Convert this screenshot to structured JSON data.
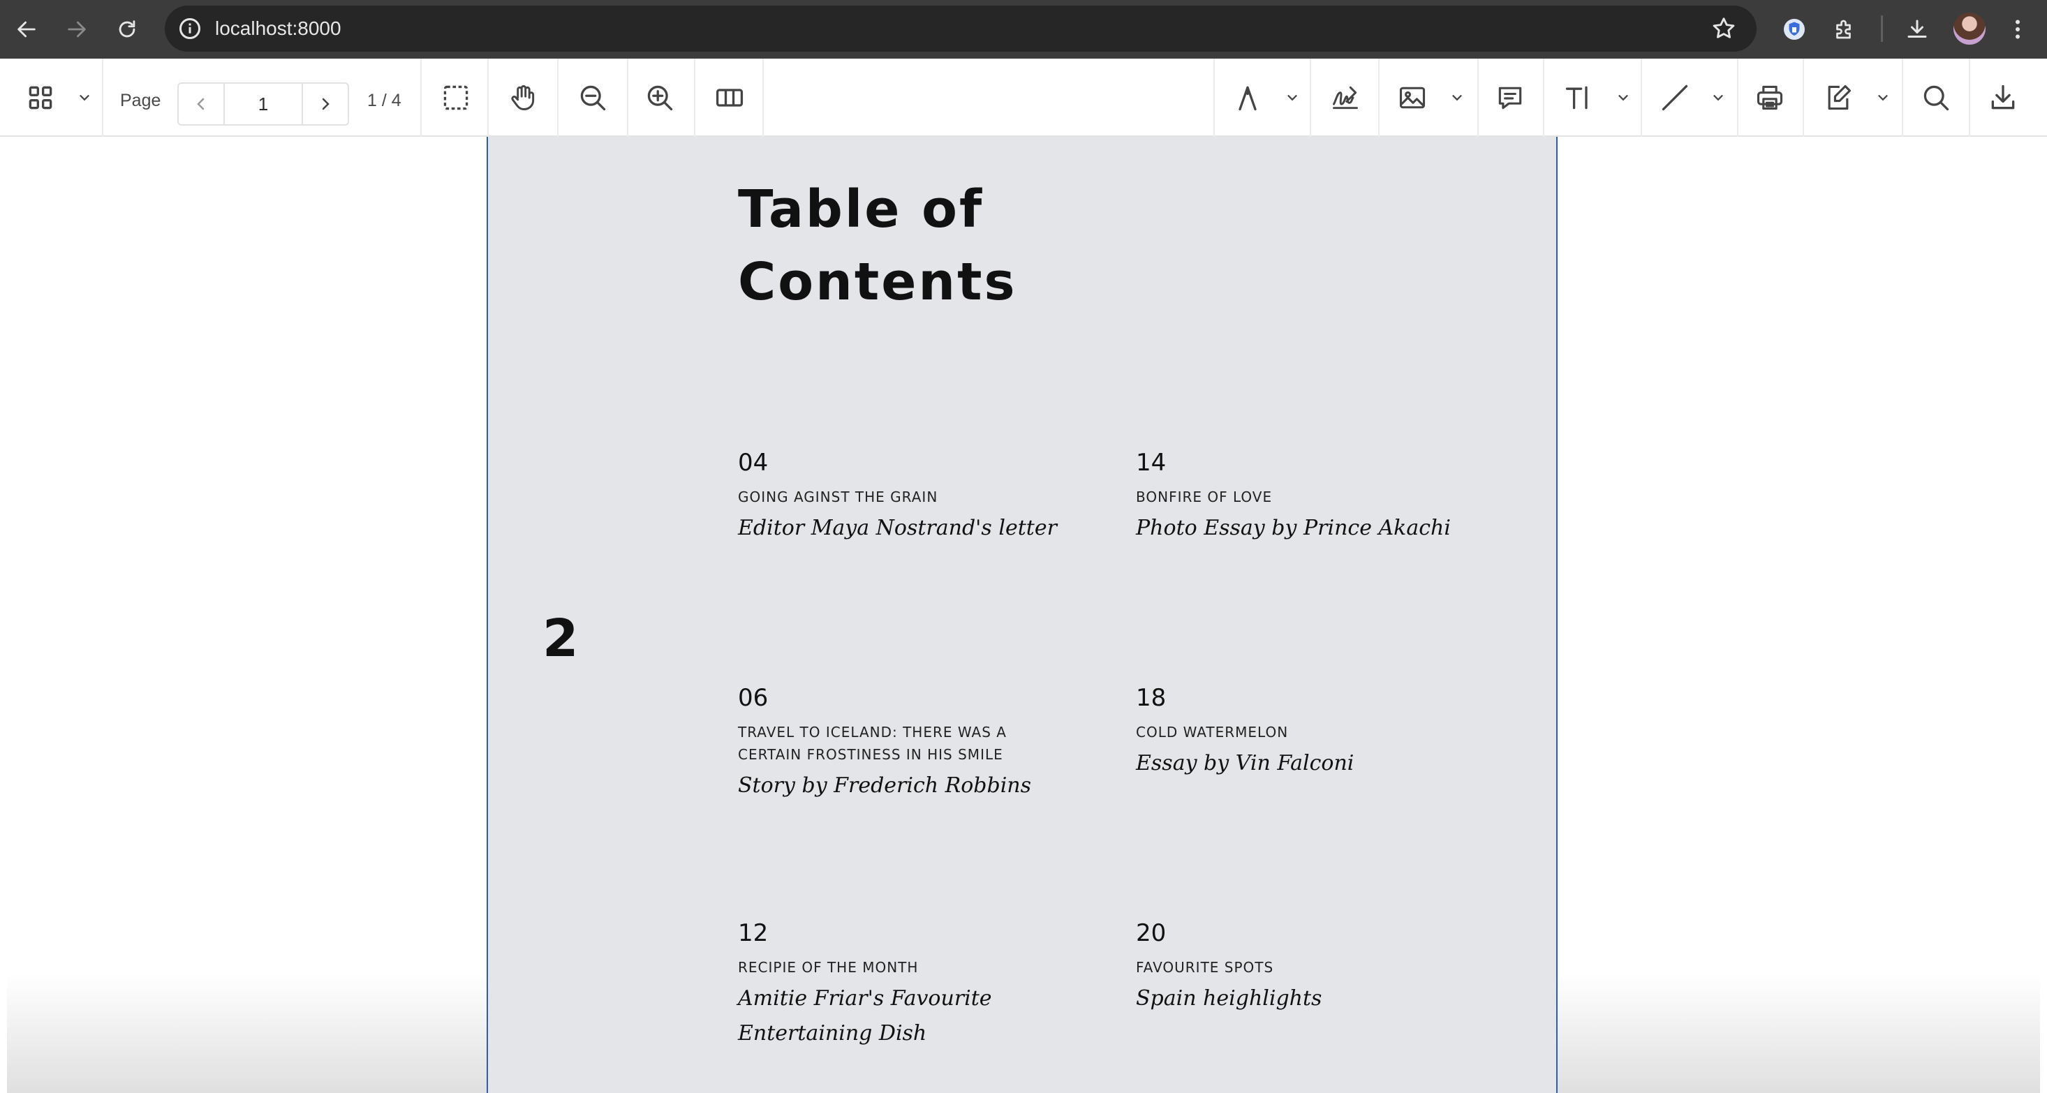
{
  "browser": {
    "url": "localhost:8000",
    "icons": [
      "back-icon",
      "forward-icon",
      "reload-icon",
      "site-info-icon",
      "bookmark-star-icon",
      "extension-shield-icon",
      "extensions-puzzle-icon",
      "downloads-icon",
      "profile-avatar",
      "kebab-menu-icon"
    ]
  },
  "toolbar": {
    "page_label": "Page",
    "page_value": "1",
    "page_count": "1 / 4"
  },
  "document": {
    "title": "Table of Contents",
    "page_number": "2",
    "entries": [
      {
        "num": "04",
        "kicker": "GOING AGINST THE GRAIN",
        "byline": "Editor Maya Nostrand's letter"
      },
      {
        "num": "14",
        "kicker": "BONFIRE OF LOVE",
        "byline": "Photo Essay by Prince Akachi"
      },
      {
        "num": "06",
        "kicker": "TRAVEL TO ICELAND: THERE WAS A CERTAIN FROSTINESS IN HIS SMILE",
        "byline": "Story by Frederich Robbins"
      },
      {
        "num": "18",
        "kicker": "COLD WATERMELON",
        "byline": "Essay by Vin Falconi"
      },
      {
        "num": "12",
        "kicker": "RECIPIE OF THE MONTH",
        "byline": "Amitie Friar's Favourite Entertaining Dish"
      },
      {
        "num": "20",
        "kicker": "FAVOURITE SPOTS",
        "byline": "Spain heighlights"
      }
    ]
  },
  "colors": {
    "chrome_bg": "#3c3c3c",
    "omnibox_bg": "#262626",
    "page_bg": "#e4e5e8",
    "page_border": "#2f5fa8"
  }
}
